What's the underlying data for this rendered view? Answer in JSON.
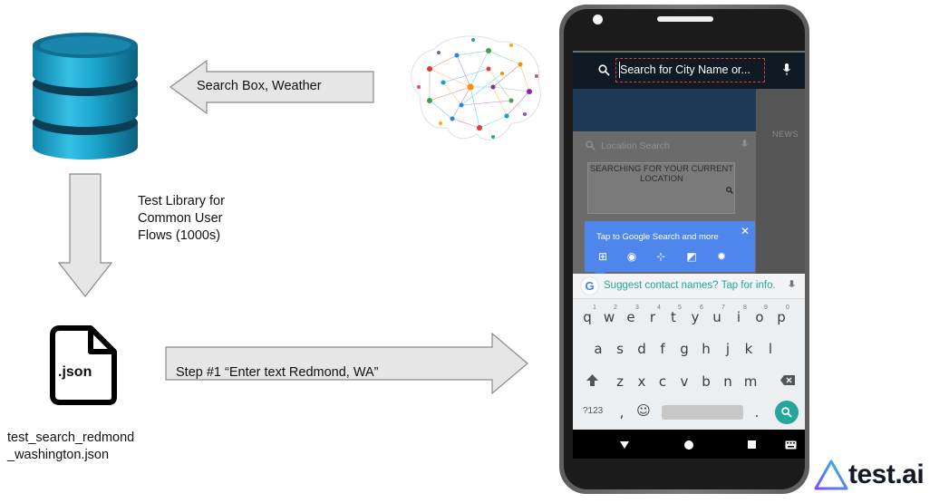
{
  "arrows": {
    "search_label": "Search Box, Weather",
    "library_label": [
      "Test Library for",
      "Common User",
      "Flows (1000s)"
    ],
    "step_label": "Step #1 “Enter text Redmond, WA”"
  },
  "file": {
    "ext_label": ".json",
    "filename_line1": "test_search_redmond",
    "filename_line2": "_washington.json"
  },
  "phone": {
    "search_placeholder": "Search for City Name or...",
    "location_search": "Location Search",
    "searching_text": "SEARCHING FOR YOUR CURRENT LOCATION",
    "news_label": "NEWS",
    "popup_text": "Tap to Google Search and more",
    "suggestion": "Suggest contact names? Tap for info.",
    "keyboard": {
      "row1": [
        "q",
        "w",
        "e",
        "r",
        "t",
        "y",
        "u",
        "i",
        "o",
        "p"
      ],
      "row1_nums": [
        "1",
        "2",
        "3",
        "4",
        "5",
        "6",
        "7",
        "8",
        "9",
        "0"
      ],
      "row2": [
        "a",
        "s",
        "d",
        "f",
        "g",
        "h",
        "j",
        "k",
        "l"
      ],
      "row3": [
        "z",
        "x",
        "c",
        "v",
        "b",
        "n",
        "m"
      ],
      "symbols_key": "?123",
      "comma": ",",
      "period": "."
    }
  },
  "brand": {
    "name": "test.ai"
  },
  "colors": {
    "db_top": "#0a6f8f",
    "db_body": "#1a9fc4",
    "arrow_fill": "#e6e6e6",
    "arrow_stroke": "#8a8a8a",
    "popup_blue": "#4f86ec",
    "accent_teal": "#26a69a",
    "highlight_red": "#e53935"
  }
}
